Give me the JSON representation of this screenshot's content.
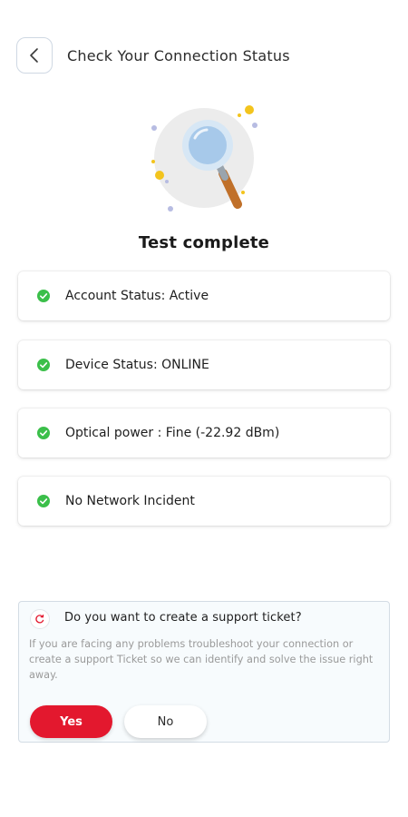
{
  "header": {
    "title": "Check Your Connection Status",
    "back_icon": "chevron-left-icon"
  },
  "illustration": {
    "icon": "magnifying-glass-icon"
  },
  "result": {
    "title": "Test complete"
  },
  "status_items": [
    {
      "label": "Account Status: Active",
      "icon": "check-circle-icon"
    },
    {
      "label": "Device Status: ONLINE",
      "icon": "check-circle-icon"
    },
    {
      "label": "Optical power : Fine (-22.92 dBm)",
      "icon": "check-circle-icon"
    },
    {
      "label": "No Network Incident",
      "icon": "check-circle-icon"
    }
  ],
  "ticket": {
    "icon": "support-icon",
    "title": "Do you want to create a support ticket?",
    "description": "If you are facing any problems troubleshoot your connection or create a support Ticket so we can identify and solve the issue right away.",
    "yes_label": "Yes",
    "no_label": "No"
  },
  "colors": {
    "accent_red": "#e3182e",
    "success_green": "#3bbf4a",
    "card_border": "#d3dce4",
    "muted_text": "#9a9a9a"
  }
}
